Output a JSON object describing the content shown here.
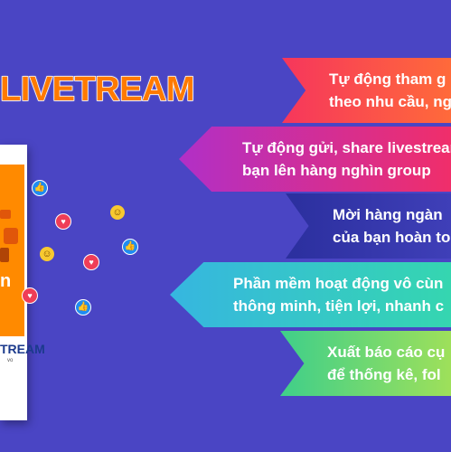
{
  "header": {
    "title": "LIVETREAM"
  },
  "product_box": {
    "letter": "n",
    "brand": "TREAM",
    "website": "vo"
  },
  "features": [
    {
      "line1": "Tự động tham g",
      "line2": "theo nhu cầu, ng"
    },
    {
      "line1": "Tự động gửi, share livestrean",
      "line2": "bạn lên hàng nghìn group"
    },
    {
      "line1": "Mời hàng ngàn",
      "line2": "của bạn hoàn to"
    },
    {
      "line1": "Phần mềm hoạt động vô cùn",
      "line2": "thông minh, tiện lợi, nhanh c"
    },
    {
      "line1": "Xuất báo cáo cụ",
      "line2": "để thống kê, fol"
    }
  ],
  "icons": {
    "like": "thumbs-up-icon",
    "heart": "heart-icon",
    "smile": "smiley-icon"
  },
  "colors": {
    "background": "#4a45c4",
    "title": "#ff7a00",
    "banner_1": "#f6365c",
    "banner_2": "#c22fb4",
    "banner_3": "#2f33a6",
    "banner_4": "#36c4cc",
    "banner_5": "#6fd870"
  }
}
